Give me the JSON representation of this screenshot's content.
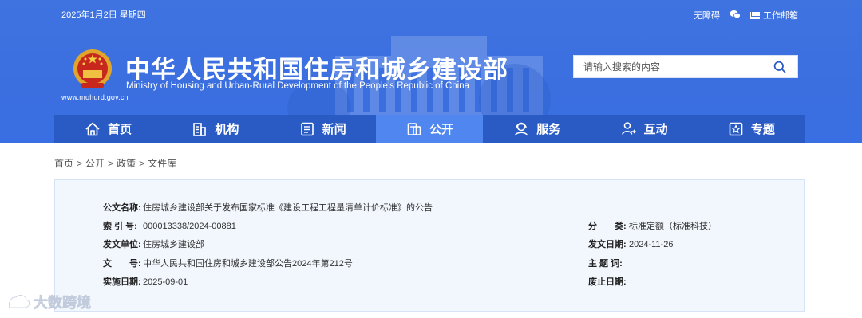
{
  "header": {
    "date": "2025年1月2日 星期四",
    "accessibility_link": "无障碍",
    "mail_link": "工作邮箱",
    "title_cn": "中华人民共和国住房和城乡建设部",
    "title_en": "Ministry of Housing and Urban-Rural Development of the People’s Republic of China",
    "site_url": "www.mohurd.gov.cn",
    "search_placeholder": "请输入搜索的内容"
  },
  "nav": [
    {
      "label": "首页",
      "icon": "home-icon"
    },
    {
      "label": "机构",
      "icon": "building-icon"
    },
    {
      "label": "新闻",
      "icon": "news-icon"
    },
    {
      "label": "公开",
      "icon": "disclosure-icon",
      "active": true
    },
    {
      "label": "服务",
      "icon": "service-icon"
    },
    {
      "label": "互动",
      "icon": "interaction-icon"
    },
    {
      "label": "专题",
      "icon": "topic-star-icon"
    }
  ],
  "breadcrumb": [
    "首页",
    "公开",
    "政策",
    "文件库"
  ],
  "document": {
    "title_label": "公文名称:",
    "title_value": "住房城乡建设部关于发布国家标准《建设工程工程量清单计价标准》的公告",
    "index_label": "索 引 号:",
    "index_value": "000013338/2024-00881",
    "category_label": "分　　类:",
    "category_value": "标准定额（标准科技）",
    "issuer_label": "发文单位:",
    "issuer_value": "住房城乡建设部",
    "issue_date_label": "发文日期:",
    "issue_date_value": "2024-11-26",
    "doc_no_label": "文　　号:",
    "doc_no_value": "中华人民共和国住房和城乡建设部公告2024年第212号",
    "subject_label": "主 题 词:",
    "subject_value": "",
    "effective_label": "实施日期:",
    "effective_value": "2025-09-01",
    "repeal_label": "废止日期:",
    "repeal_value": ""
  },
  "watermark": "大数跨境",
  "colors": {
    "header_blue": "#3f73e0",
    "nav_blue": "#2a5bc5",
    "nav_active": "#4f86f0",
    "panel_bg": "#f2f6fd"
  }
}
